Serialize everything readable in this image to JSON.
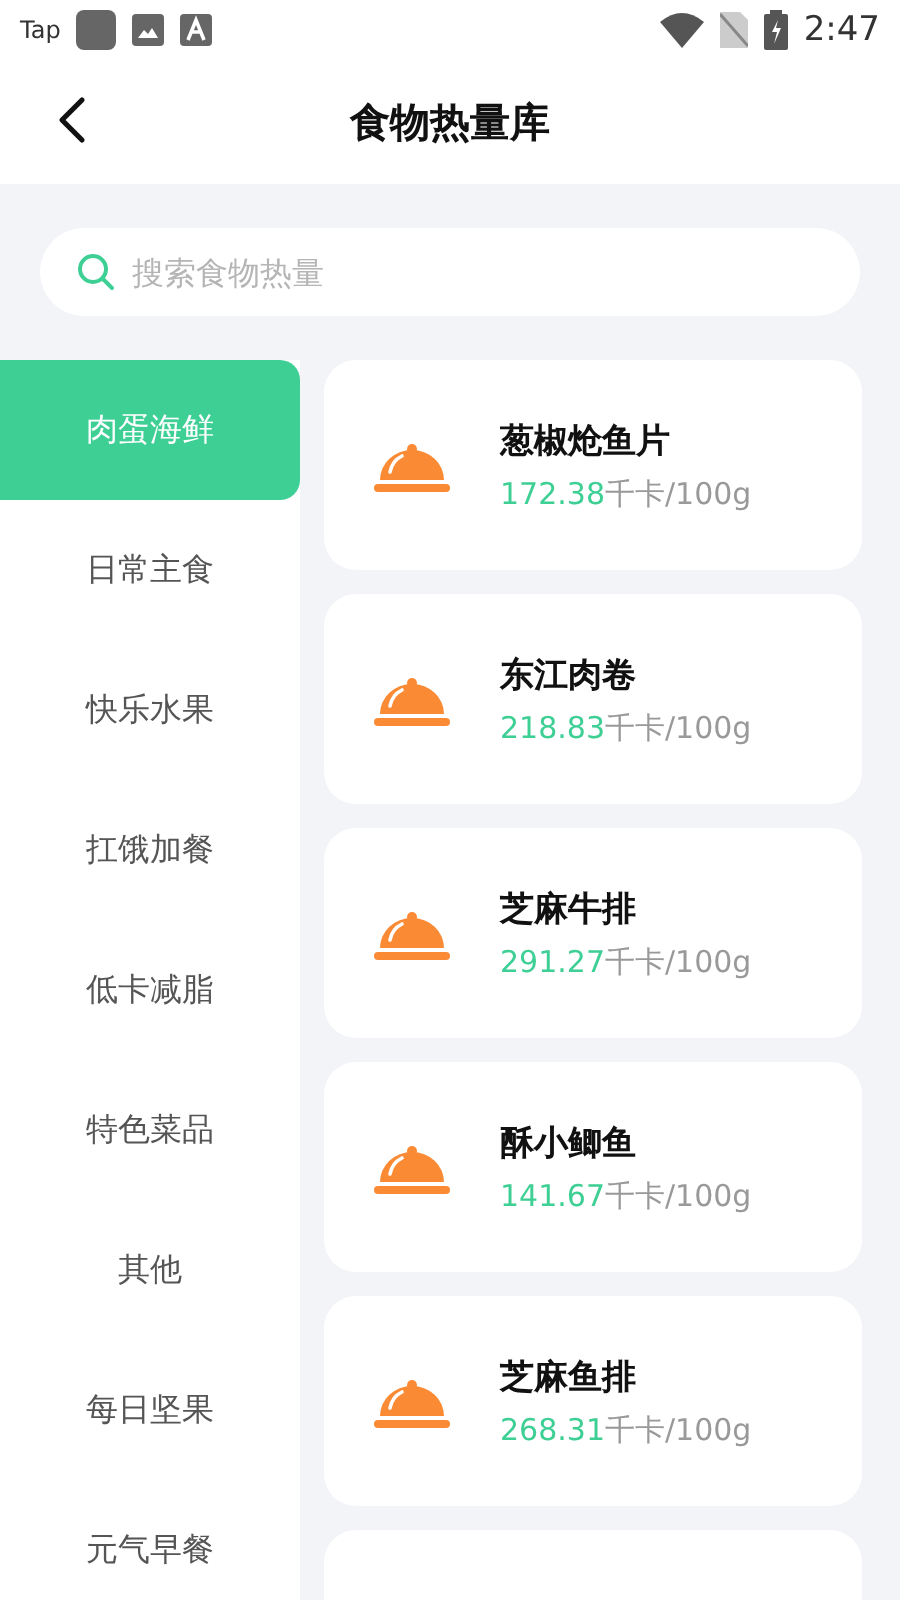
{
  "status_bar": {
    "app_label": "Tap",
    "time": "2:47"
  },
  "header": {
    "title": "食物热量库"
  },
  "search": {
    "placeholder": "搜索食物热量"
  },
  "categories": [
    {
      "label": "肉蛋海鲜",
      "selected": true
    },
    {
      "label": "日常主食",
      "selected": false
    },
    {
      "label": "快乐水果",
      "selected": false
    },
    {
      "label": "扛饿加餐",
      "selected": false
    },
    {
      "label": "低卡减脂",
      "selected": false
    },
    {
      "label": "特色菜品",
      "selected": false
    },
    {
      "label": "其他",
      "selected": false
    },
    {
      "label": "每日坚果",
      "selected": false
    },
    {
      "label": "元气早餐",
      "selected": false
    }
  ],
  "foods": [
    {
      "kind": "item",
      "name": "葱椒炝鱼片",
      "calories": "172.38",
      "unit": "千卡/100g"
    },
    {
      "kind": "item",
      "name": "东江肉卷",
      "calories": "218.83",
      "unit": "千卡/100g"
    },
    {
      "kind": "item",
      "name": "芝麻牛排",
      "calories": "291.27",
      "unit": "千卡/100g"
    },
    {
      "kind": "item",
      "name": "酥小鲫鱼",
      "calories": "141.67",
      "unit": "千卡/100g"
    },
    {
      "kind": "item",
      "name": "芝麻鱼排",
      "calories": "268.31",
      "unit": "千卡/100g"
    },
    {
      "kind": "partial"
    }
  ]
}
